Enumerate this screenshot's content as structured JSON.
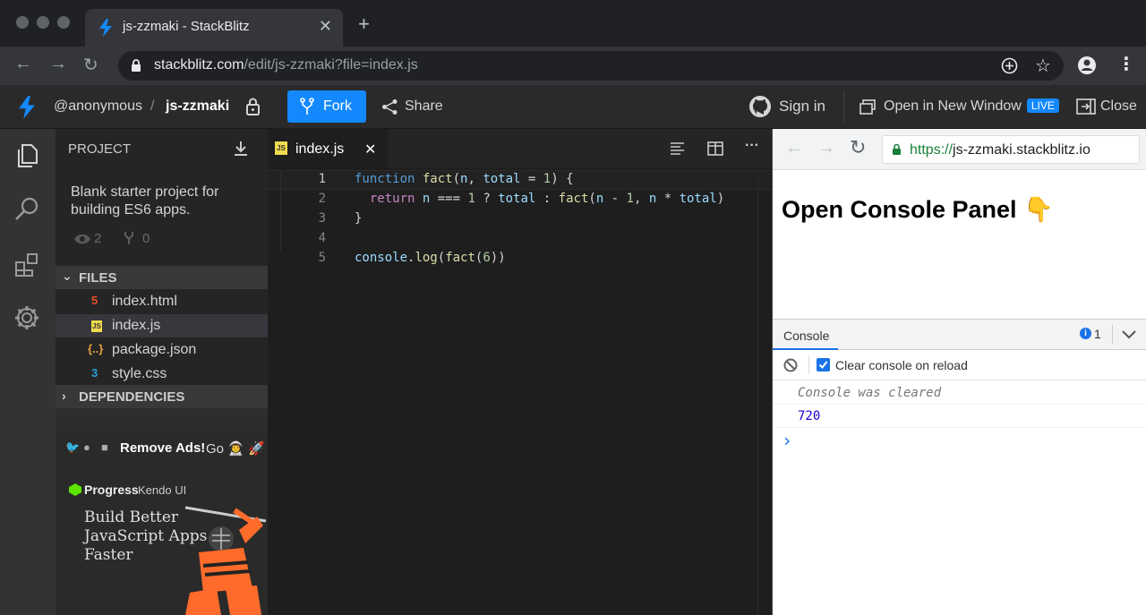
{
  "browser": {
    "tab_title": "js-zzmaki - StackBlitz",
    "tab_close": "✕",
    "new_tab": "+",
    "url_host": "stackblitz.com",
    "url_path": "/edit/js-zzmaki?file=index.js"
  },
  "header": {
    "user": "@anonymous",
    "separator": "/",
    "project": "js-zzmaki",
    "fork_label": "Fork",
    "share_label": "Share",
    "signin_label": "Sign in",
    "open_new_window_label": "Open in New Window",
    "live_badge": "LIVE",
    "close_label": "Close"
  },
  "sidebar": {
    "project_title": "PROJECT",
    "description": "Blank starter project for building ES6 apps.",
    "views": "2",
    "forks": "0",
    "files_title": "FILES",
    "files": [
      {
        "name": "index.html",
        "icon": "5",
        "color": "#e44d26"
      },
      {
        "name": "index.js",
        "icon": "JS",
        "color": "#f0db4f"
      },
      {
        "name": "package.json",
        "icon": "{..}",
        "color": "#e8a33e"
      },
      {
        "name": "style.css",
        "icon": "3",
        "color": "#2a9fd6"
      }
    ],
    "dependencies_title": "DEPENDENCIES",
    "ads_text": "Remove Ads!",
    "ads_go": "Go 👨‍🚀 🚀",
    "ad_brand": "Progress",
    "ad_product": "Kendo UI",
    "ad_line1": "Build Better",
    "ad_line2": "JavaScript Apps",
    "ad_line3": "Faster"
  },
  "editor": {
    "tab_label": "index.js",
    "tab_close": "✕",
    "line_numbers": [
      "1",
      "2",
      "3",
      "4",
      "5"
    ]
  },
  "preview": {
    "url_scheme": "https://",
    "url_host": "js-zzmaki.stackblitz.io",
    "heading": "Open Console Panel 👇",
    "console_tab": "Console",
    "info_count": "1",
    "clear_on_reload": "Clear console on reload",
    "log_cleared": "Console was cleared",
    "log_value": "720",
    "prompt": "›"
  },
  "colors": {
    "accent": "#1389fd",
    "editor_bg": "#1e1e1e",
    "sidebar_bg": "#252526"
  }
}
